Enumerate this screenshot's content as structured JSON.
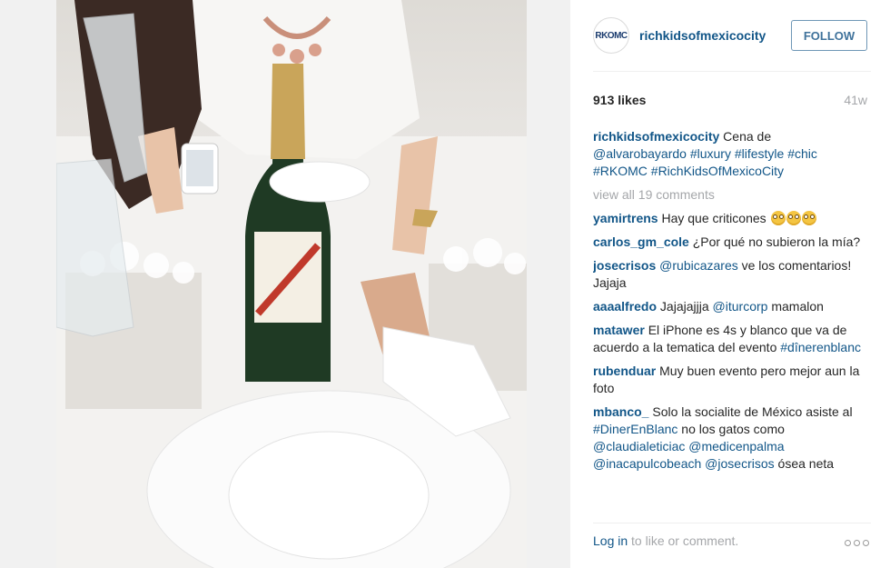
{
  "post": {
    "image_alt": "Champagne bottle on table with holding hands"
  },
  "header": {
    "avatar_text": "RKOMC",
    "username": "richkidsofmexicocity",
    "follow_label": "FOLLOW"
  },
  "stats": {
    "likes": "913 likes",
    "age": "41w"
  },
  "caption": {
    "author": "richkidsofmexicocity",
    "text": " Cena de ",
    "mention": "@alvarobayardo",
    "tags": "#luxury #lifestyle #chic #RKOMC #RichKidsOfMexicoCity"
  },
  "view_all": "view all 19 comments",
  "comments": [
    {
      "author": "yamirtrens",
      "text": " Hay que criticones "
    },
    {
      "author": "carlos_gm_cole",
      "text": " ¿Por qué no subieron la mía?"
    },
    {
      "author": "josecrisos",
      "mention": "@rubicazares",
      "text": " ve los comentarios! Jajaja"
    },
    {
      "author": "aaaalfredo",
      "text": " Jajajajjja ",
      "mention": "@iturcorp",
      "text2": " mamalon"
    },
    {
      "author": "matawer",
      "text": " El iPhone es 4s y blanco que va de acuerdo a la tematica del evento ",
      "tag": "#dînerenblanc"
    },
    {
      "author": "rubenduar",
      "text": " Muy buen evento pero mejor aun la foto"
    },
    {
      "author": "mbanco_",
      "text": " Solo la socialite de México asiste al ",
      "tag": "#DinerEnBlanc",
      "text2": " no los gatos como ",
      "mentions": "@claudialeticiac @medicenpalma @inacapulcobeach @josecrisos",
      "text3": " ósea neta"
    }
  ],
  "footer": {
    "login": "Log in",
    "rest": " to like or comment."
  }
}
